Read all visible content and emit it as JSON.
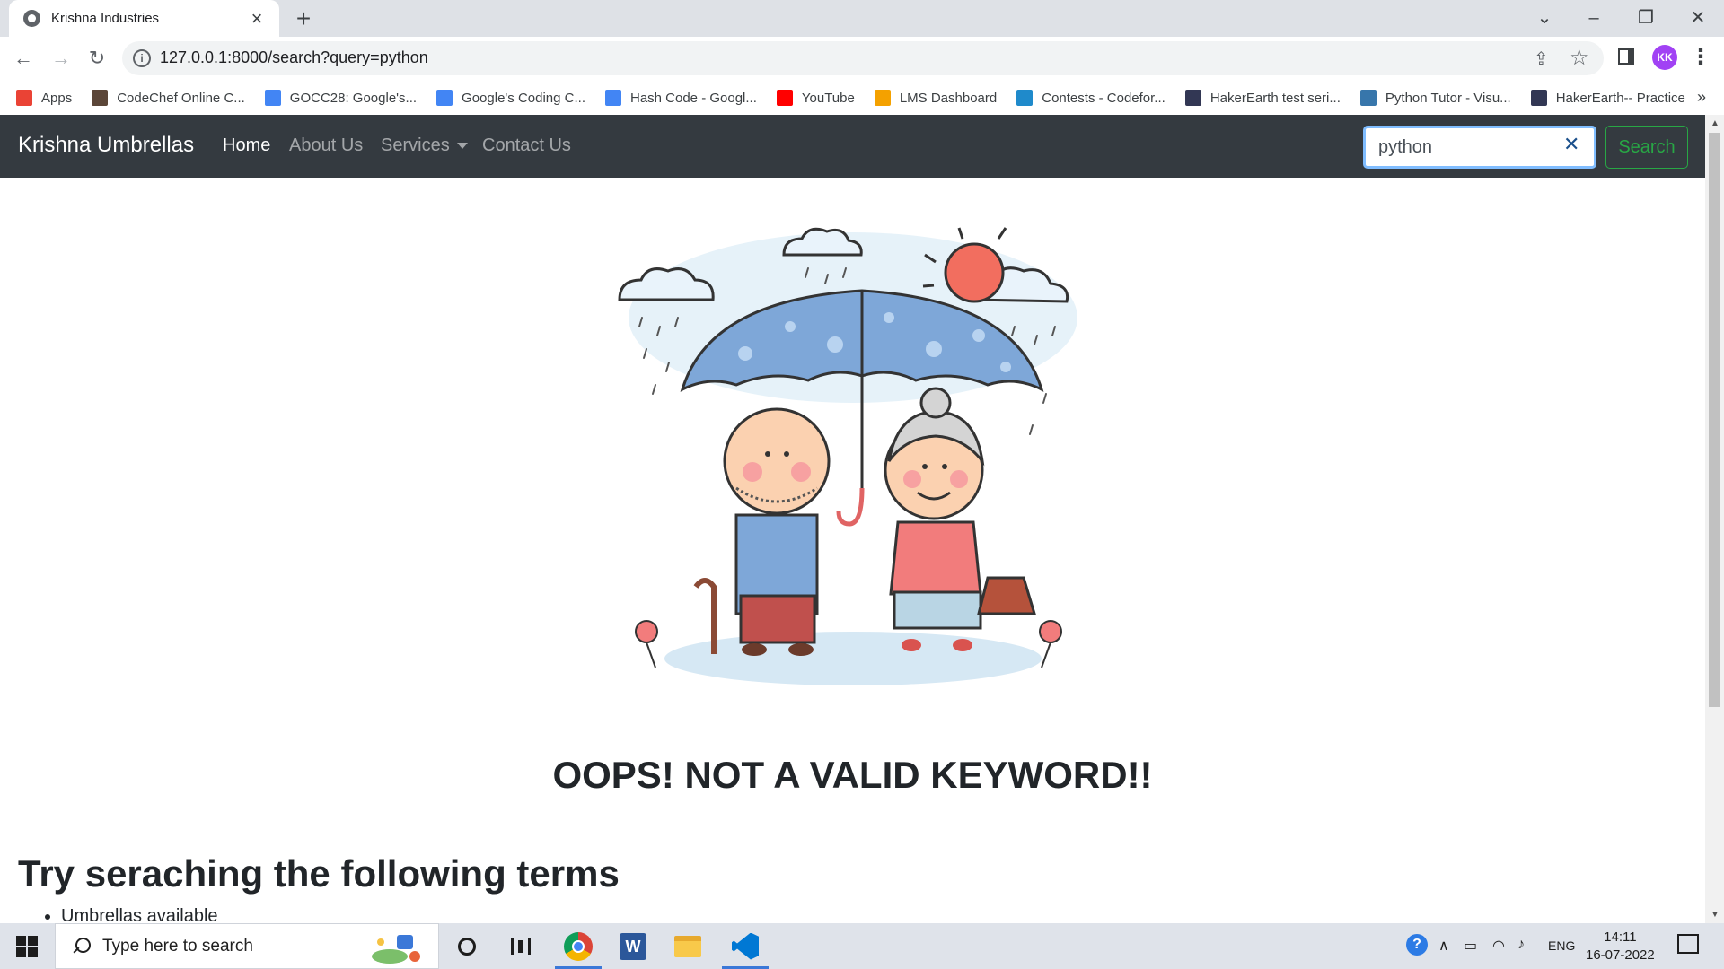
{
  "browser": {
    "tab_title": "Krishna Industries",
    "url": "127.0.0.1:8000/search?query=python",
    "profile_initials": "KK",
    "bookmarks": [
      {
        "label": "Apps",
        "icon": "apps-grid-icon",
        "color": "#ea4335"
      },
      {
        "label": "CodeChef Online C...",
        "icon": "codechef-icon",
        "color": "#5b4638"
      },
      {
        "label": "GOCC28: Google's...",
        "icon": "google-icon",
        "color": "#4285f4"
      },
      {
        "label": "Google's Coding C...",
        "icon": "google-icon",
        "color": "#4285f4"
      },
      {
        "label": "Hash Code - Googl...",
        "icon": "google-icon",
        "color": "#4285f4"
      },
      {
        "label": "YouTube",
        "icon": "youtube-icon",
        "color": "#ff0000"
      },
      {
        "label": "LMS Dashboard",
        "icon": "lms-icon",
        "color": "#f4a100"
      },
      {
        "label": "Contests - Codefor...",
        "icon": "codeforces-icon",
        "color": "#1f8acb"
      },
      {
        "label": "HakerEarth test seri...",
        "icon": "hackerearth-icon",
        "color": "#323754"
      },
      {
        "label": "Python Tutor - Visu...",
        "icon": "python-icon",
        "color": "#3776ab"
      },
      {
        "label": "HakerEarth-- Practice",
        "icon": "hackerearth-icon",
        "color": "#323754"
      }
    ]
  },
  "site": {
    "brand": "Krishna Umbrellas",
    "nav": {
      "home": "Home",
      "about": "About Us",
      "services": "Services",
      "contact": "Contact Us"
    },
    "search": {
      "value": "python",
      "button": "Search"
    }
  },
  "main": {
    "error_heading": "OOPS! NOT A VALID KEYWORD!!",
    "suggest_heading": "Try seraching the following terms",
    "suggestions": [
      "Umbrellas available"
    ]
  },
  "taskbar": {
    "search_placeholder": "Type here to search",
    "language": "ENG",
    "time": "14:11",
    "date": "16-07-2022"
  },
  "colors": {
    "navbar_bg": "#343a40",
    "search_button": "#28a745",
    "chrome_tabstrip": "#dee1e6"
  }
}
